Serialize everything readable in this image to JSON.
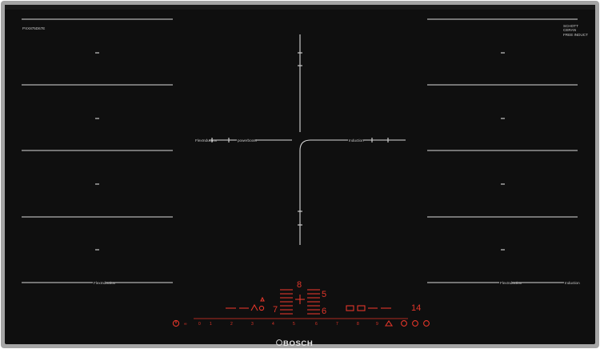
{
  "labels": {
    "model_code": "PXX875D67E",
    "schott_ceran": [
      "SCHOTT",
      "CERAN"
    ],
    "schott_sub": "FREE INDUCT",
    "left_flex": "FlexInduction",
    "power_boost": "powerboost",
    "induction_center": "Induction",
    "right_flex_bottom": "FlexInduction",
    "induction_right": "Induction",
    "left_flex_bottom": "FlexInduction",
    "brand": "BOSCH"
  },
  "display": {
    "center_top_digit": "8",
    "center_digit_1": "5",
    "center_digit_2": "6",
    "left_digit": "7",
    "right_readout": "14",
    "scale": [
      "0",
      "1",
      "2",
      "3",
      "4",
      "5",
      "6",
      "7",
      "8",
      "9"
    ]
  },
  "colors": {
    "glass": "#0f0f0f",
    "frame": "#9a9a9a",
    "control_red": "#e2362a",
    "marking": "#d8d8d8"
  },
  "icons": {
    "power": "power-icon",
    "lock": "child-lock-icon",
    "timer": "timer-icon",
    "menu": "menu-icon"
  }
}
